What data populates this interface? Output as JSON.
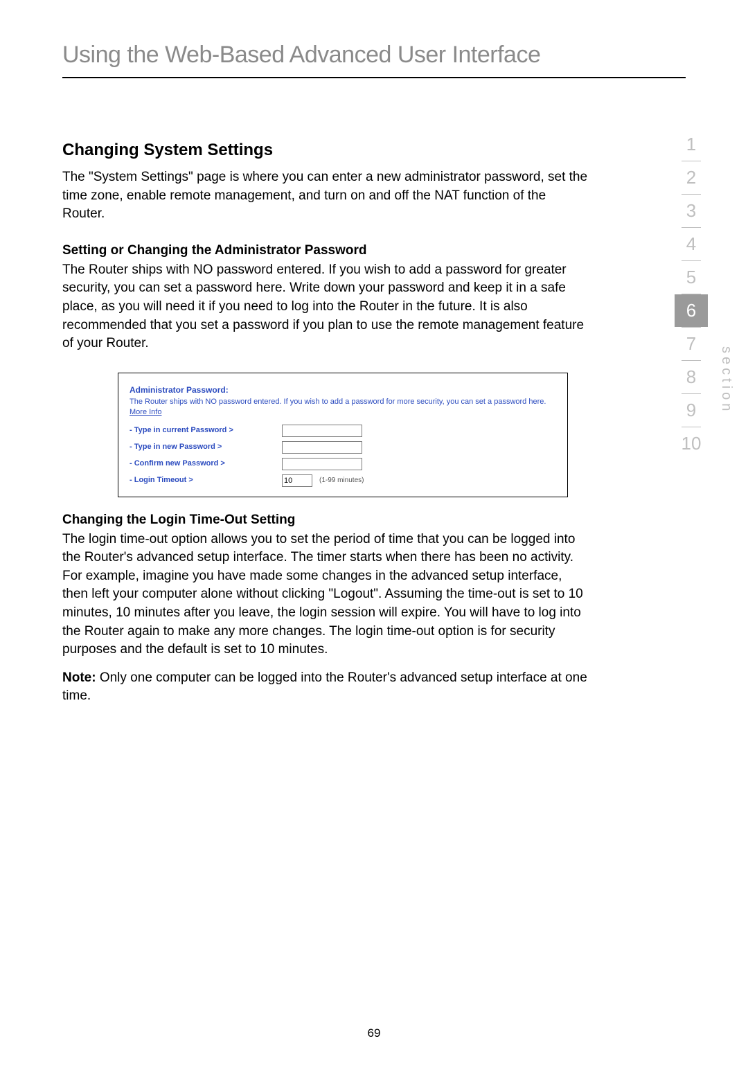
{
  "title": "Using the Web-Based Advanced User Interface",
  "page_number": "69",
  "section_label": "section",
  "section_nav": {
    "items": [
      "1",
      "2",
      "3",
      "4",
      "5",
      "6",
      "7",
      "8",
      "9",
      "10"
    ],
    "active_index": 5
  },
  "body": {
    "h2_changing": "Changing System Settings",
    "p_intro": "The \"System Settings\" page is where you can enter a new administrator password, set the time zone, enable remote management, and turn on and off the NAT function of the Router.",
    "h3_admin": "Setting or Changing the Administrator Password",
    "p_admin": "The Router ships with NO password entered. If you wish to add a password for greater security, you can set a password here. Write down your password and keep it in a safe place, as you will need it if you need to log into the Router in the future. It is also recommended that you set a password if you plan to use the remote management feature of your Router.",
    "h3_timeout": "Changing the Login Time-Out Setting",
    "p_timeout": "The login time-out option allows you to set the period of time that you can be logged into the Router's advanced setup interface. The timer starts when there has been no activity. For example, imagine you have made some changes in the advanced setup interface, then left your computer alone without clicking \"Logout\". Assuming the time-out is set to 10 minutes, 10 minutes after you leave, the login session will expire. You will have to log into the Router again to make any more changes. The login time-out option is for security purposes and the default is set to 10 minutes.",
    "note_label": "Note:",
    "p_note": " Only one computer can be logged into the Router's advanced setup interface at one time."
  },
  "panel": {
    "title": "Administrator Password:",
    "desc_prefix": "The Router ships with NO password entered. If you wish to add a password for more security, you can set a password here. ",
    "more_info": "More Info",
    "rows": {
      "current": "- Type in current Password >",
      "new": "- Type in new Password >",
      "confirm": "- Confirm new Password >",
      "timeout": "- Login Timeout >"
    },
    "timeout_value": "10",
    "timeout_hint": "(1-99 minutes)"
  }
}
